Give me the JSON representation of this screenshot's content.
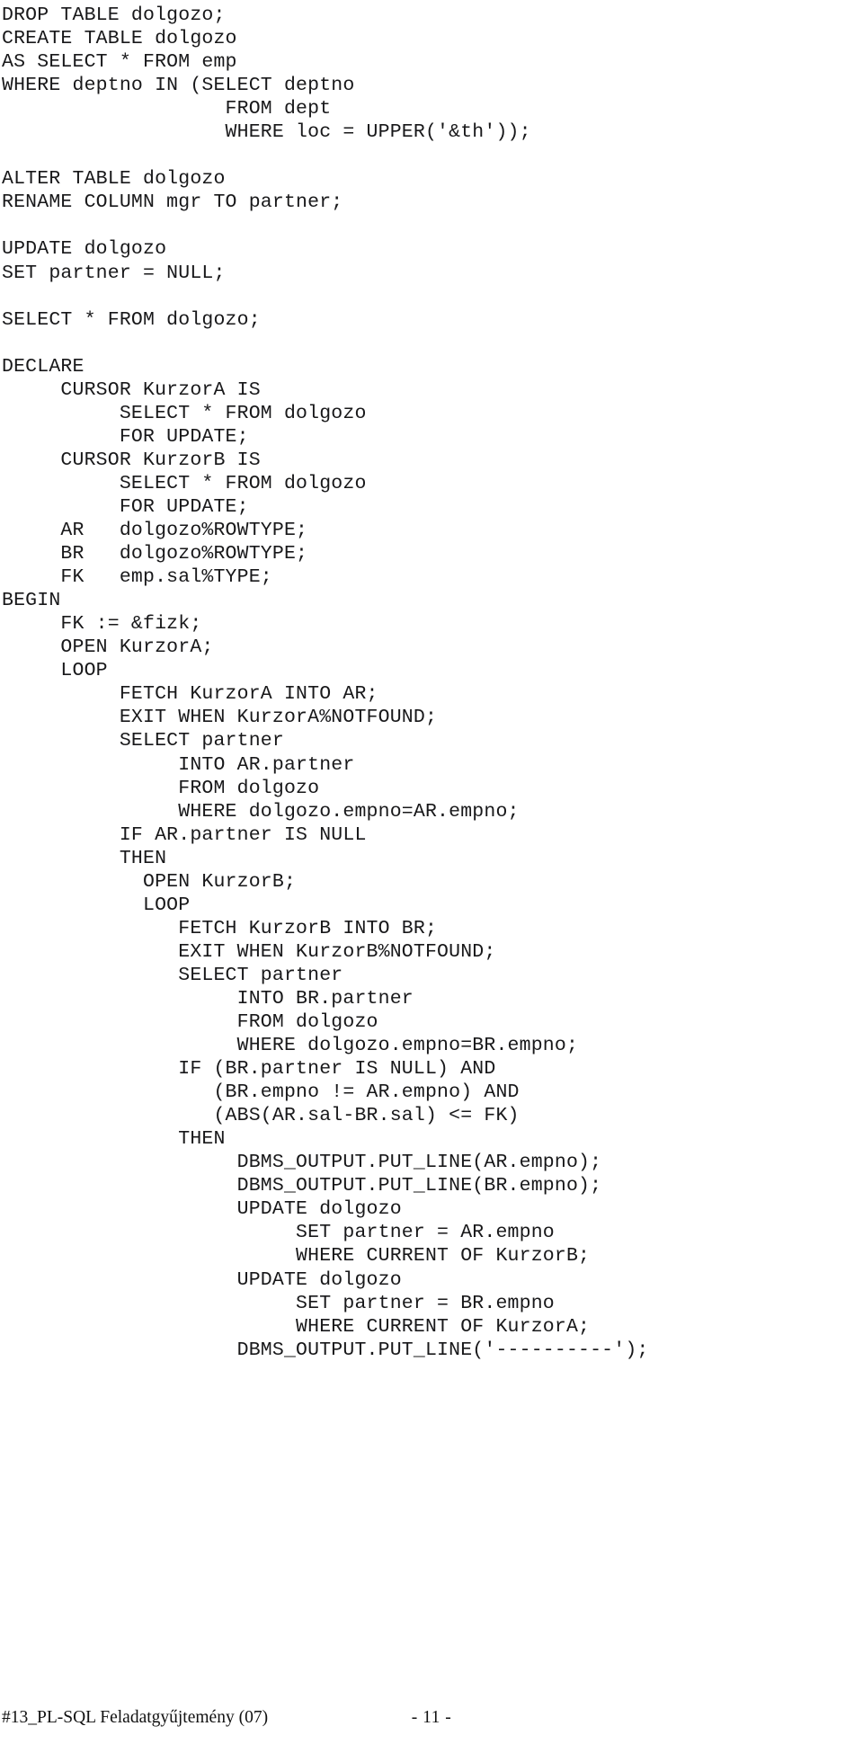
{
  "document": {
    "page_number_label": "- 11 -",
    "footer_title": "#13_PL-SQL Feladatgyűjtemény (07)",
    "text_color": "#18181a",
    "background_color": "#ffffff"
  },
  "code": {
    "language": "PL/SQL",
    "lines": [
      "DROP TABLE dolgozo;",
      "CREATE TABLE dolgozo",
      "AS SELECT * FROM emp",
      "WHERE deptno IN (SELECT deptno",
      "                   FROM dept",
      "                   WHERE loc = UPPER('&th'));",
      "",
      "ALTER TABLE dolgozo",
      "RENAME COLUMN mgr TO partner;",
      "",
      "UPDATE dolgozo",
      "SET partner = NULL;",
      "",
      "SELECT * FROM dolgozo;",
      "",
      "DECLARE",
      "     CURSOR KurzorA IS",
      "          SELECT * FROM dolgozo",
      "          FOR UPDATE;",
      "     CURSOR KurzorB IS",
      "          SELECT * FROM dolgozo",
      "          FOR UPDATE;",
      "     AR   dolgozo%ROWTYPE;",
      "     BR   dolgozo%ROWTYPE;",
      "     FK   emp.sal%TYPE;",
      "BEGIN",
      "     FK := &fizk;",
      "     OPEN KurzorA;",
      "     LOOP",
      "          FETCH KurzorA INTO AR;",
      "          EXIT WHEN KurzorA%NOTFOUND;",
      "          SELECT partner",
      "               INTO AR.partner",
      "               FROM dolgozo",
      "               WHERE dolgozo.empno=AR.empno;",
      "          IF AR.partner IS NULL",
      "          THEN",
      "            OPEN KurzorB;",
      "            LOOP",
      "               FETCH KurzorB INTO BR;",
      "               EXIT WHEN KurzorB%NOTFOUND;",
      "               SELECT partner",
      "                    INTO BR.partner",
      "                    FROM dolgozo",
      "                    WHERE dolgozo.empno=BR.empno;",
      "               IF (BR.partner IS NULL) AND",
      "                  (BR.empno != AR.empno) AND",
      "                  (ABS(AR.sal-BR.sal) <= FK)",
      "               THEN",
      "                    DBMS_OUTPUT.PUT_LINE(AR.empno);",
      "                    DBMS_OUTPUT.PUT_LINE(BR.empno);",
      "                    UPDATE dolgozo",
      "                         SET partner = AR.empno",
      "                         WHERE CURRENT OF KurzorB;",
      "                    UPDATE dolgozo",
      "                         SET partner = BR.empno",
      "                         WHERE CURRENT OF KurzorA;",
      "                    DBMS_OUTPUT.PUT_LINE('----------');"
    ]
  }
}
